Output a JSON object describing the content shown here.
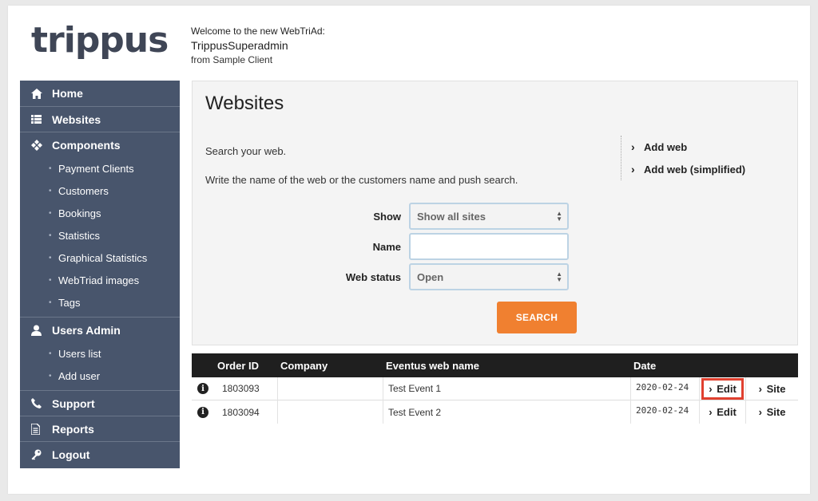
{
  "logo": {
    "text": "trippus"
  },
  "welcome": {
    "line1": "Welcome to the new WebTriAd:",
    "user": "TrippusSuperadmin",
    "client": "from Sample Client"
  },
  "sidebar": {
    "items": [
      {
        "label": "Home",
        "icon": "home-icon"
      },
      {
        "label": "Websites",
        "icon": "list-icon"
      },
      {
        "label": "Components",
        "icon": "components-icon"
      },
      {
        "label": "Payment Clients"
      },
      {
        "label": "Customers"
      },
      {
        "label": "Bookings"
      },
      {
        "label": "Statistics"
      },
      {
        "label": "Graphical Statistics"
      },
      {
        "label": "WebTriad images"
      },
      {
        "label": "Tags"
      },
      {
        "label": "Users Admin",
        "icon": "user-icon"
      },
      {
        "label": "Users list"
      },
      {
        "label": "Add user"
      },
      {
        "label": "Support",
        "icon": "phone-icon"
      },
      {
        "label": "Reports",
        "icon": "document-icon"
      },
      {
        "label": "Logout",
        "icon": "key-icon"
      }
    ]
  },
  "panel": {
    "title": "Websites",
    "text1": "Search your web.",
    "text2": "Write the name of the web or the customers name and push search.",
    "links": [
      "Add web",
      "Add web (simplified)"
    ],
    "form": {
      "show_label": "Show",
      "show_value": "Show all sites",
      "name_label": "Name",
      "name_value": "",
      "status_label": "Web status",
      "status_value": "Open",
      "search_label": "SEARCH"
    }
  },
  "table": {
    "headers": [
      "Order ID",
      "Company",
      "Eventus web name",
      "Date"
    ],
    "rows": [
      {
        "order": "1803093",
        "company": "",
        "web": "Test Event 1",
        "date": "2020-02-24",
        "edit": "Edit",
        "site": "Site"
      },
      {
        "order": "1803094",
        "company": "",
        "web": "Test Event 2",
        "date": "2020-02-24",
        "edit": "Edit",
        "site": "Site"
      }
    ]
  },
  "colors": {
    "sidebar": "#48556c",
    "accent": "#f08030",
    "highlight": "#e0402f",
    "table_header": "#1f1f1f"
  }
}
